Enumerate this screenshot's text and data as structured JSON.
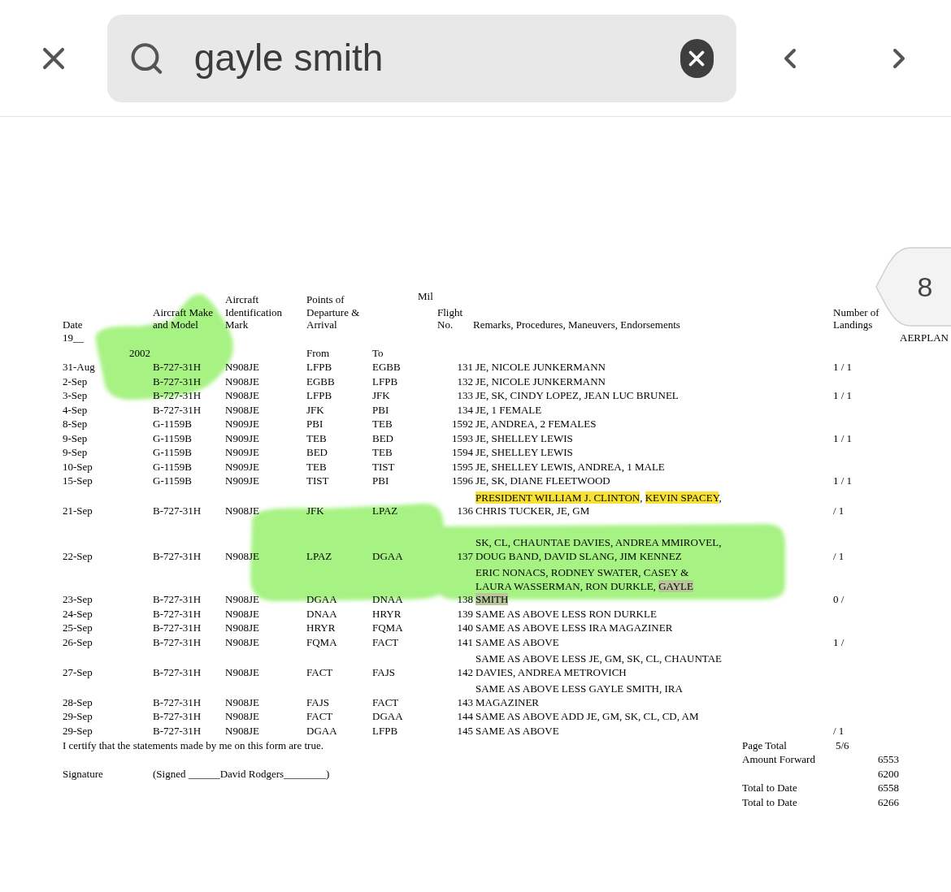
{
  "toolbar": {
    "search": {
      "value": "gayle smith"
    }
  },
  "page_badge": "8",
  "log": {
    "header": {
      "mil": "Mil",
      "columns": [
        {
          "lines": [
            "Date",
            "19__"
          ]
        },
        {
          "lines": [
            "Aircraft Make",
            "and Model"
          ]
        },
        {
          "lines": [
            "Aircraft",
            "Identification",
            "Mark"
          ]
        },
        {
          "lines": [
            "Points of",
            "Departure &",
            "Arrival"
          ]
        },
        {
          "lines": [
            "Flight",
            "No."
          ]
        },
        {
          "lines": [
            "Remarks, Procedures, Maneuvers, Endorsements"
          ]
        },
        {
          "lines": [
            "Number of",
            "Landings"
          ]
        },
        {
          "lines": [
            "AERPLAN"
          ]
        }
      ]
    },
    "subheader": {
      "year": "2002",
      "from": "From",
      "to": "To"
    },
    "rows": [
      {
        "date": "31-Aug",
        "model": "B-727-31H",
        "ident": "N908JE",
        "from": "LFPB",
        "to": "EGBB",
        "flight": "131",
        "remarks": [
          [
            {
              "text": "JE, NICOLE JUNKERMANN"
            }
          ]
        ],
        "landings": "1 / 1"
      },
      {
        "date": "2-Sep",
        "model": "B-727-31H",
        "ident": "N908JE",
        "from": "EGBB",
        "to": "LFPB",
        "flight": "132",
        "remarks": [
          [
            {
              "text": "JE, NICOLE JUNKERMANN"
            }
          ]
        ]
      },
      {
        "date": "3-Sep",
        "model": "B-727-31H",
        "ident": "N908JE",
        "from": "LFPB",
        "to": "JFK",
        "flight": "133",
        "remarks": [
          [
            {
              "text": "JE, SK, CINDY LOPEZ, JEAN LUC BRUNEL"
            }
          ]
        ],
        "landings": "1 / 1"
      },
      {
        "date": "4-Sep",
        "model": "B-727-31H",
        "ident": "N908JE",
        "from": "JFK",
        "to": "PBI",
        "flight": "134",
        "remarks": [
          [
            {
              "text": "JE, 1 FEMALE"
            }
          ]
        ]
      },
      {
        "date": "8-Sep",
        "model": "G-1159B",
        "ident": "N909JE",
        "from": "PBI",
        "to": "TEB",
        "flight": "1592",
        "remarks": [
          [
            {
              "text": "JE, ANDREA, 2 FEMALES"
            }
          ]
        ]
      },
      {
        "date": "9-Sep",
        "model": "G-1159B",
        "ident": "N909JE",
        "from": "TEB",
        "to": "BED",
        "flight": "1593",
        "remarks": [
          [
            {
              "text": "JE, SHELLEY LEWIS"
            }
          ]
        ],
        "landings": "1 / 1"
      },
      {
        "date": "9-Sep",
        "model": "G-1159B",
        "ident": "N909JE",
        "from": "BED",
        "to": "TEB",
        "flight": "1594",
        "remarks": [
          [
            {
              "text": "JE, SHELLEY LEWIS"
            }
          ]
        ]
      },
      {
        "date": "10-Sep",
        "model": "G-1159B",
        "ident": "N909JE",
        "from": "TEB",
        "to": "TIST",
        "flight": "1595",
        "remarks": [
          [
            {
              "text": "JE, SHELLEY LEWIS, ANDREA, 1 MALE"
            }
          ]
        ]
      },
      {
        "date": "15-Sep",
        "model": "G-1159B",
        "ident": "N909JE",
        "from": "TIST",
        "to": "PBI",
        "flight": "1596",
        "remarks": [
          [
            {
              "text": "JE, SK, DIANE FLEETWOOD"
            }
          ]
        ],
        "landings": "1 / 1"
      },
      {
        "date": "21-Sep",
        "model": "B-727-31H",
        "ident": "N908JE",
        "from": "JFK",
        "to": "LPAZ",
        "flight": "136",
        "remarks": [
          [
            {
              "text": "PRESIDENT WILLIAM J. CLINTON",
              "highlighted": true
            },
            {
              "text": ", "
            },
            {
              "text": "KEVIN SPACEY",
              "highlighted": true
            },
            {
              "text": ","
            }
          ],
          [
            {
              "text": "CHRIS TUCKER, JE, GM"
            }
          ]
        ],
        "landings": "/ 1"
      },
      {
        "date": "22-Sep",
        "model": "B-727-31H",
        "ident": "N908JE",
        "from": "LPAZ",
        "to": "DGAA",
        "flight": "137",
        "remarks": [
          [
            {
              "text": "SK, CL, CHAUNTAE DAVIES, ANDREA MMIROVEL,"
            }
          ],
          [
            {
              "text": "DOUG BAND, DAVID SLANG, JIM KENNEZ"
            }
          ]
        ],
        "landings": "/ 1"
      },
      {
        "date": "23-Sep",
        "model": "B-727-31H",
        "ident": "N908JE",
        "from": "DGAA",
        "to": "DNAA",
        "flight": "138",
        "remarks": [
          [
            {
              "text": "ERIC NONACS, RODNEY SWATER, CASEY &"
            }
          ],
          [
            {
              "text": "LAURA WASSERMAN, RON DURKLE, "
            },
            {
              "text": "GAYLE",
              "search_match": true
            }
          ],
          [
            {
              "text": "SMITH",
              "search_match": true
            }
          ]
        ],
        "landings": "0 /"
      },
      {
        "date": "24-Sep",
        "model": "B-727-31H",
        "ident": "N908JE",
        "from": "DNAA",
        "to": "HRYR",
        "flight": "139",
        "remarks": [
          [
            {
              "text": "SAME AS ABOVE LESS RON DURKLE"
            }
          ]
        ]
      },
      {
        "date": "25-Sep",
        "model": "B-727-31H",
        "ident": "N908JE",
        "from": "HRYR",
        "to": "FQMA",
        "flight": "140",
        "remarks": [
          [
            {
              "text": "SAME AS ABOVE LESS IRA MAGAZINER"
            }
          ]
        ]
      },
      {
        "date": "26-Sep",
        "model": "B-727-31H",
        "ident": "N908JE",
        "from": "FQMA",
        "to": "FACT",
        "flight": "141",
        "remarks": [
          [
            {
              "text": "SAME AS ABOVE"
            }
          ]
        ],
        "landings": "1 /"
      },
      {
        "date": "27-Sep",
        "model": "B-727-31H",
        "ident": "N908JE",
        "from": "FACT",
        "to": "FAJS",
        "flight": "142",
        "remarks": [
          [
            {
              "text": "SAME AS ABOVE LESS JE, GM, SK, CL, CHAUNTAE"
            }
          ],
          [
            {
              "text": "DAVIES, ANDREA METROVICH"
            }
          ]
        ]
      },
      {
        "date": "28-Sep",
        "model": "B-727-31H",
        "ident": "N908JE",
        "from": "FAJS",
        "to": "FACT",
        "flight": "143",
        "remarks": [
          [
            {
              "text": "SAME AS ABOVE LESS GAYLE SMITH, IRA"
            }
          ],
          [
            {
              "text": "MAGAZINER"
            }
          ]
        ]
      },
      {
        "date": "29-Sep",
        "model": "B-727-31H",
        "ident": "N908JE",
        "from": "FACT",
        "to": "DGAA",
        "flight": "144",
        "remarks": [
          [
            {
              "text": "SAME AS ABOVE ADD JE, GM, SK, CL, CD, AM"
            }
          ]
        ]
      },
      {
        "date": "29-Sep",
        "model": "B-727-31H",
        "ident": "N908JE",
        "from": "DGAA",
        "to": "LFPB",
        "flight": "145",
        "remarks": [
          [
            {
              "text": "SAME AS ABOVE"
            }
          ]
        ],
        "landings": "/ 1"
      }
    ],
    "footer": {
      "certification": "I certify that the statements made by me on this form are true.",
      "signature_label": "Signature",
      "signature": "(Signed ______David Rodgers________)",
      "totals": [
        {
          "label": "Page Total",
          "value": "5/6",
          "kind": "fraction"
        },
        {
          "label": "Amount Forward",
          "value": "6553",
          "kind": "amount"
        },
        {
          "value": "6200",
          "kind": "amount"
        },
        {
          "label": "Total to Date",
          "value": "6558",
          "kind": "amount"
        },
        {
          "label": "Total to Date",
          "value": "6266",
          "kind": "amount"
        }
      ]
    }
  }
}
